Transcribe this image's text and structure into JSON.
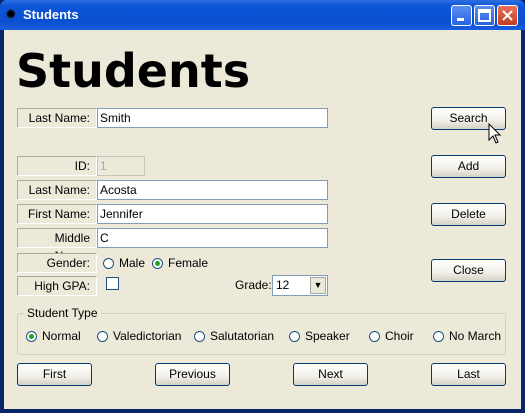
{
  "window": {
    "title": "Students",
    "icon": "gear-icon"
  },
  "heading": "Students",
  "search": {
    "label": "Last Name:",
    "value": "Smith",
    "button": "Search"
  },
  "record": {
    "id_label": "ID:",
    "id_value": "1",
    "last_label": "Last Name:",
    "last_value": "Acosta",
    "first_label": "First Name:",
    "first_value": "Jennifer",
    "middle_label": "Middle Name:",
    "middle_value": "C",
    "gender_label": "Gender:",
    "gender_options": [
      "Male",
      "Female"
    ],
    "gender_selected": "Female",
    "gpa_label": "High GPA:",
    "gpa_checked": false,
    "grade_label": "Grade:",
    "grade_value": "12"
  },
  "actions": {
    "add": "Add",
    "delete": "Delete",
    "close": "Close"
  },
  "student_type": {
    "title": "Student Type",
    "options": [
      "Normal",
      "Valedictorian",
      "Salutatorian",
      "Speaker",
      "Choir",
      "No March"
    ],
    "selected": "Normal"
  },
  "nav": {
    "first": "First",
    "previous": "Previous",
    "next": "Next",
    "last": "Last"
  }
}
